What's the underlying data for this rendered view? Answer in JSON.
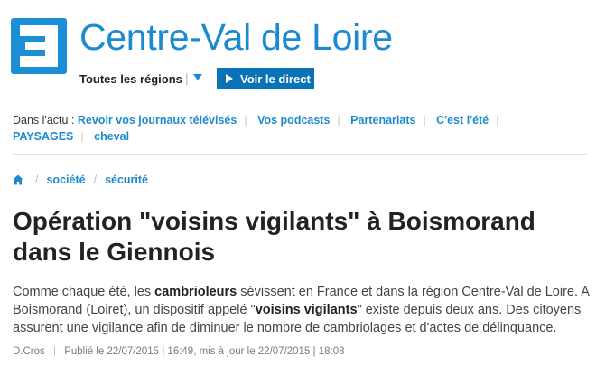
{
  "header": {
    "logo_icon": "france3-logo-icon",
    "title": "Centre-Val de Loire",
    "regions_label": "Toutes les régions",
    "live_button": "Voir le direct"
  },
  "actu": {
    "label": "Dans l'actu :",
    "links": [
      "Revoir vos journaux télévisés",
      "Vos podcasts",
      "Partenariats",
      "C'est l'été",
      "PAYSAGES",
      "cheval"
    ]
  },
  "breadcrumb": {
    "home_icon": "home-icon",
    "items": [
      "société",
      "sécurité"
    ]
  },
  "article": {
    "title": "Opération \"voisins vigilants\" à Boismorand dans le Giennois",
    "lead": {
      "p1": "Comme chaque été, les ",
      "b1": "cambrioleurs",
      "p2": " sévissent en France et dans la région Centre-Val de Loire. A Boismorand (Loiret), un dispositif appelé \"",
      "b2": "voisins vigilants",
      "p3": "\" existe depuis deux ans. Des citoyens assurent une vigilance afin de diminuer le nombre de cambriolages et d'actes de délinquance."
    },
    "author": "D.Cros",
    "published": "Publié le 22/07/2015 | 16:49, mis à jour le 22/07/2015 | 18:08"
  },
  "colors": {
    "brand_blue": "#1d8ad0",
    "button_blue": "#0a73b8"
  }
}
